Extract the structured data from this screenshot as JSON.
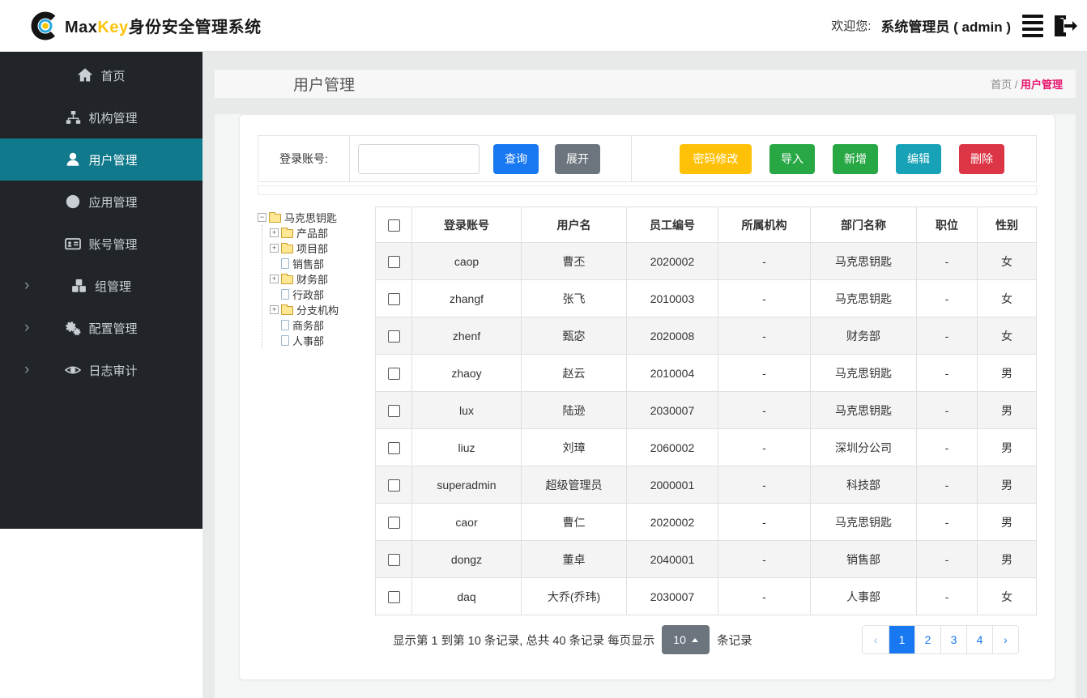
{
  "header": {
    "brand_max": "Max",
    "brand_key": "Key",
    "brand_suffix": "身份安全管理系统",
    "welcome_label": "欢迎您:",
    "user": "系统管理员 ( admin )"
  },
  "colors": {
    "primary_blue": "#1778f2",
    "sidebar_bg": "#212529",
    "sidebar_active_teal": "#11798c",
    "warning_yellow": "#ffc107",
    "success_green": "#28a745",
    "info_teal": "#17a2b8",
    "danger_red": "#dc3545",
    "breadcrumb_pink": "#e7156d",
    "brand_gold": "#fdc20a",
    "pager_gray": "#6c757d"
  },
  "sidebar": {
    "items": [
      {
        "label": "首页",
        "icon": "home-icon",
        "active": false,
        "chevron": false
      },
      {
        "label": "机构管理",
        "icon": "sitemap-icon",
        "active": false,
        "chevron": false
      },
      {
        "label": "用户管理",
        "icon": "user-icon",
        "active": true,
        "chevron": false
      },
      {
        "label": "应用管理",
        "icon": "globe-icon",
        "active": false,
        "chevron": false
      },
      {
        "label": "账号管理",
        "icon": "id-card-icon",
        "active": false,
        "chevron": false
      },
      {
        "label": "组管理",
        "icon": "cubes-icon",
        "active": false,
        "chevron": true
      },
      {
        "label": "配置管理",
        "icon": "gears-icon",
        "active": false,
        "chevron": true
      },
      {
        "label": "日志审计",
        "icon": "eye-icon",
        "active": false,
        "chevron": true
      }
    ]
  },
  "page": {
    "title": "用户管理",
    "breadcrumb_home": "首页",
    "breadcrumb_sep": "/",
    "breadcrumb_current": "用户管理"
  },
  "search": {
    "label": "登录账号:",
    "input_value": "",
    "query_label": "查询",
    "expand_label": "展开",
    "actions": [
      {
        "label": "密码修改",
        "color": "#ffc107"
      },
      {
        "label": "导入",
        "color": "#28a745"
      },
      {
        "label": "新增",
        "color": "#28a745"
      },
      {
        "label": "编辑",
        "color": "#17a2b8"
      },
      {
        "label": "删除",
        "color": "#dc3545"
      }
    ]
  },
  "tree": {
    "root": "马克思钥匙",
    "children": [
      {
        "label": "产品部",
        "type": "folder",
        "expandable": true
      },
      {
        "label": "项目部",
        "type": "folder",
        "expandable": true
      },
      {
        "label": "销售部",
        "type": "leaf",
        "expandable": false
      },
      {
        "label": "财务部",
        "type": "folder",
        "expandable": true
      },
      {
        "label": "行政部",
        "type": "leaf",
        "expandable": false
      },
      {
        "label": "分支机构",
        "type": "folder",
        "expandable": true
      },
      {
        "label": "商务部",
        "type": "leaf",
        "expandable": false
      },
      {
        "label": "人事部",
        "type": "leaf",
        "expandable": false
      }
    ]
  },
  "table": {
    "headers": [
      "登录账号",
      "用户名",
      "员工编号",
      "所属机构",
      "部门名称",
      "职位",
      "性别"
    ],
    "rows": [
      [
        "caop",
        "曹丕",
        "2020002",
        "-",
        "马克思钥匙",
        "-",
        "女"
      ],
      [
        "zhangf",
        "张飞",
        "2010003",
        "-",
        "马克思钥匙",
        "-",
        "女"
      ],
      [
        "zhenf",
        "甄宓",
        "2020008",
        "-",
        "财务部",
        "-",
        "女"
      ],
      [
        "zhaoy",
        "赵云",
        "2010004",
        "-",
        "马克思钥匙",
        "-",
        "男"
      ],
      [
        "lux",
        "陆逊",
        "2030007",
        "-",
        "马克思钥匙",
        "-",
        "男"
      ],
      [
        "liuz",
        "刘璋",
        "2060002",
        "-",
        "深圳分公司",
        "-",
        "男"
      ],
      [
        "superadmin",
        "超级管理员",
        "2000001",
        "-",
        "科技部",
        "-",
        "男"
      ],
      [
        "caor",
        "曹仁",
        "2020002",
        "-",
        "马克思钥匙",
        "-",
        "男"
      ],
      [
        "dongz",
        "董卓",
        "2040001",
        "-",
        "销售部",
        "-",
        "男"
      ],
      [
        "daq",
        "大乔(乔玮)",
        "2030007",
        "-",
        "人事部",
        "-",
        "女"
      ]
    ]
  },
  "pagination": {
    "summary_prefix": "显示第 1 到第 10 条记录, 总共 40 条记录  每页显示",
    "per_page": "10",
    "summary_suffix": "条记录",
    "pages": [
      {
        "label": "‹",
        "state": "prev"
      },
      {
        "label": "1",
        "state": "active"
      },
      {
        "label": "2",
        "state": "normal"
      },
      {
        "label": "3",
        "state": "normal"
      },
      {
        "label": "4",
        "state": "normal"
      },
      {
        "label": "›",
        "state": "next"
      }
    ]
  }
}
